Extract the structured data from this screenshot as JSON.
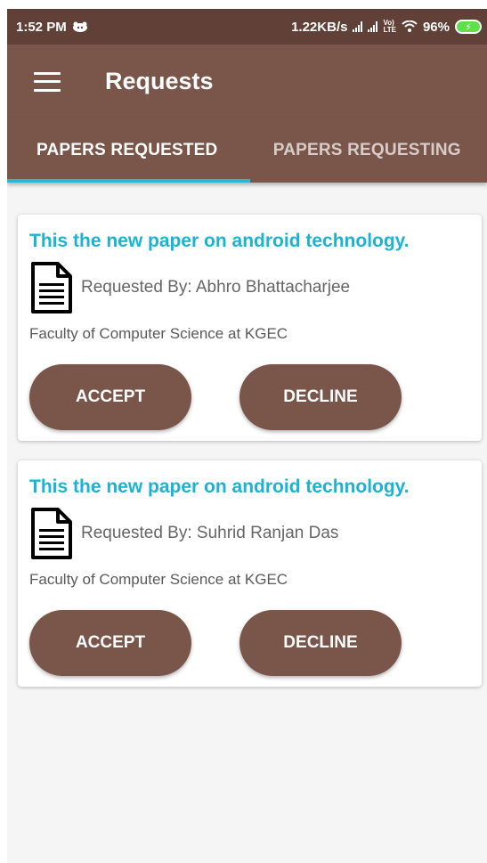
{
  "status_bar": {
    "time": "1:52 PM",
    "net_speed": "1.22KB/s",
    "lte_top": "Vo)",
    "lte_bottom": "LTE",
    "battery_percent": "96%"
  },
  "appbar": {
    "title": "Requests",
    "menu_icon": "menu-icon"
  },
  "tabs": [
    {
      "label": "PAPERS REQUESTED",
      "active": true
    },
    {
      "label": "PAPERS REQUESTING",
      "active": false
    }
  ],
  "requests": [
    {
      "title": "This the new paper on android technology.",
      "requested_by": "Requested By: Abhro Bhattacharjee",
      "faculty": "Faculty of Computer Science at KGEC",
      "accept_label": "ACCEPT",
      "decline_label": "DECLINE"
    },
    {
      "title": "This the new paper on android technology.",
      "requested_by": "Requested By: Suhrid Ranjan Das",
      "faculty": "Faculty of Computer Science at KGEC",
      "accept_label": "ACCEPT",
      "decline_label": "DECLINE"
    }
  ],
  "colors": {
    "status_bar": "#614037",
    "primary": "#79554a",
    "accent": "#29b6d9",
    "card_title": "#1ab3d6"
  }
}
